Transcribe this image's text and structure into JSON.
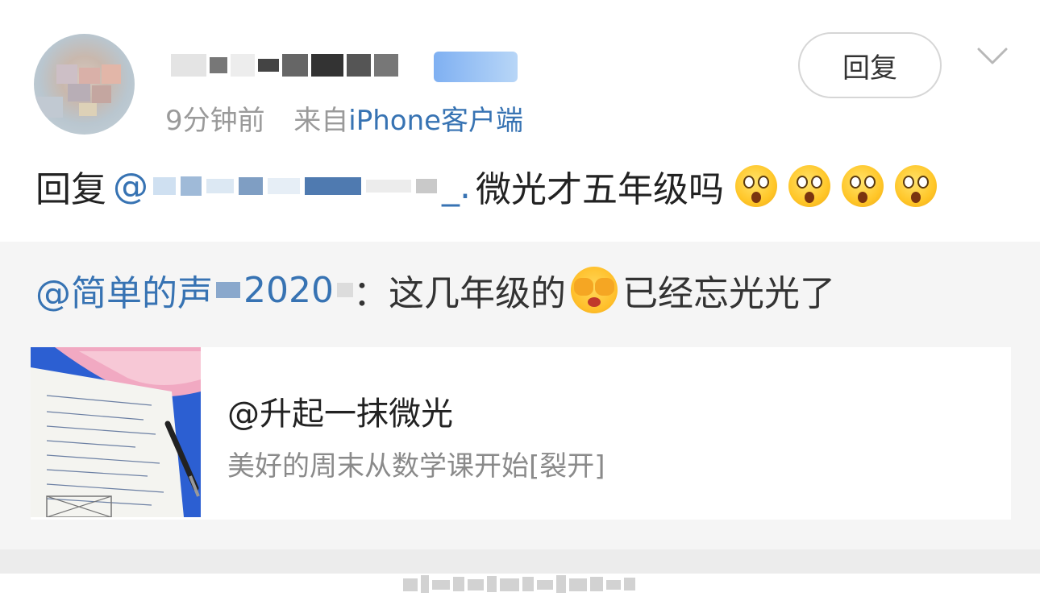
{
  "comment": {
    "meta_time": "9分钟前",
    "meta_from": "来自",
    "meta_source": "iPhone客户端",
    "reply_prefix": "回复",
    "mention_at": "@",
    "mention_tail": "_.",
    "text": "微光才五年级吗"
  },
  "actions": {
    "reply_label": "回复"
  },
  "quote": {
    "prefix": "@简单的声",
    "year": "2020",
    "text_a": "：这几年级的",
    "text_b": "已经忘光光了"
  },
  "card": {
    "title": "@升起一抹微光",
    "description": "美好的周末从数学课开始[裂开]"
  },
  "colors": {
    "link": "#3773b3",
    "meta_gray": "#9a9a9a",
    "quote_bg": "#f5f5f5",
    "vip_badge": "#7fb0f2"
  },
  "icons": {
    "avatar": "user-avatar",
    "emoji_surprised": "shocked-face-emoji",
    "emoji_hide": "hiding-face-emoji",
    "dropdown": "chevron-down-icon"
  }
}
